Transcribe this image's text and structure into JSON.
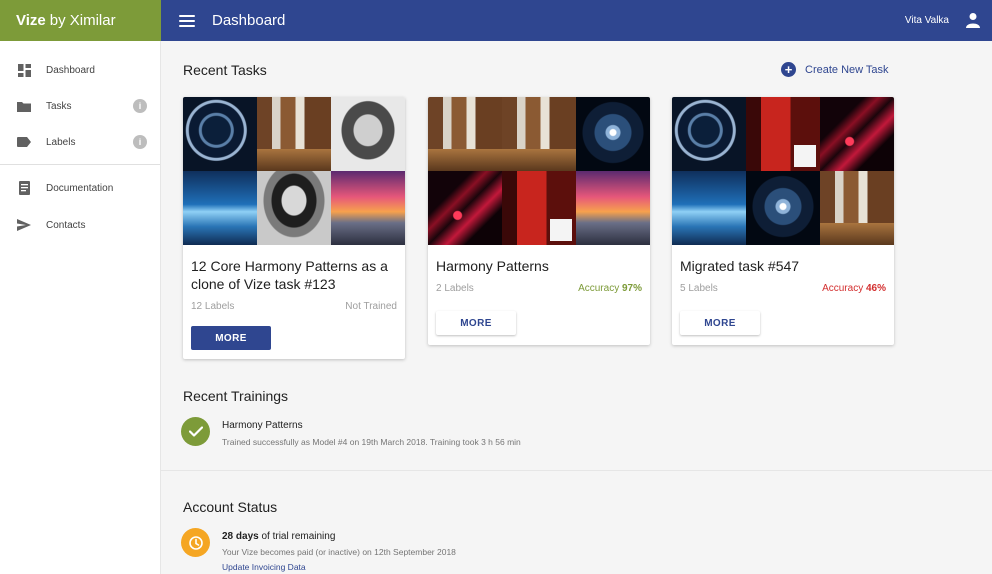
{
  "brand": {
    "name": "Vize",
    "suffix": "by Ximilar"
  },
  "header": {
    "title": "Dashboard",
    "user_name": "Vita Valka"
  },
  "sidebar": {
    "items": [
      {
        "label": "Dashboard",
        "icon": "dashboard-icon"
      },
      {
        "label": "Tasks",
        "icon": "folder-icon",
        "badge": "i"
      },
      {
        "label": "Labels",
        "icon": "label-icon",
        "badge": "i"
      },
      {
        "label": "Documentation",
        "icon": "document-icon"
      },
      {
        "label": "Contacts",
        "icon": "send-icon"
      }
    ]
  },
  "recent_tasks": {
    "title": "Recent Tasks",
    "create_label": "Create New Task",
    "cards": [
      {
        "title": "12 Core Harmony Patterns as a clone of Vize task #123",
        "labels": "12 Labels",
        "status": "Not Trained",
        "more": "MORE"
      },
      {
        "title": "Harmony Patterns",
        "labels": "2 Labels",
        "status_prefix": "Accuracy",
        "status_value": "97%",
        "more": "MORE"
      },
      {
        "title": "Migrated task #547",
        "labels": "5 Labels",
        "status_prefix": "Accuracy",
        "status_value": "46%",
        "more": "MORE"
      }
    ]
  },
  "recent_trainings": {
    "title": "Recent Trainings",
    "item": {
      "name": "Harmony Patterns",
      "description": "Trained successfully as Model #4 on 19th March 2018. Training took 3 h 56 min"
    }
  },
  "account_status": {
    "title": "Account Status",
    "days": "28 days",
    "days_suffix": "of trial remaining",
    "note": "Your Vize becomes paid (or inactive) on 12th September 2018",
    "link": "Update Invoicing Data"
  },
  "colors": {
    "brand": "#7d9b39",
    "primary": "#2f4690",
    "success": "#7d9b39",
    "danger": "#d32f2f",
    "warning": "#f5a623"
  }
}
